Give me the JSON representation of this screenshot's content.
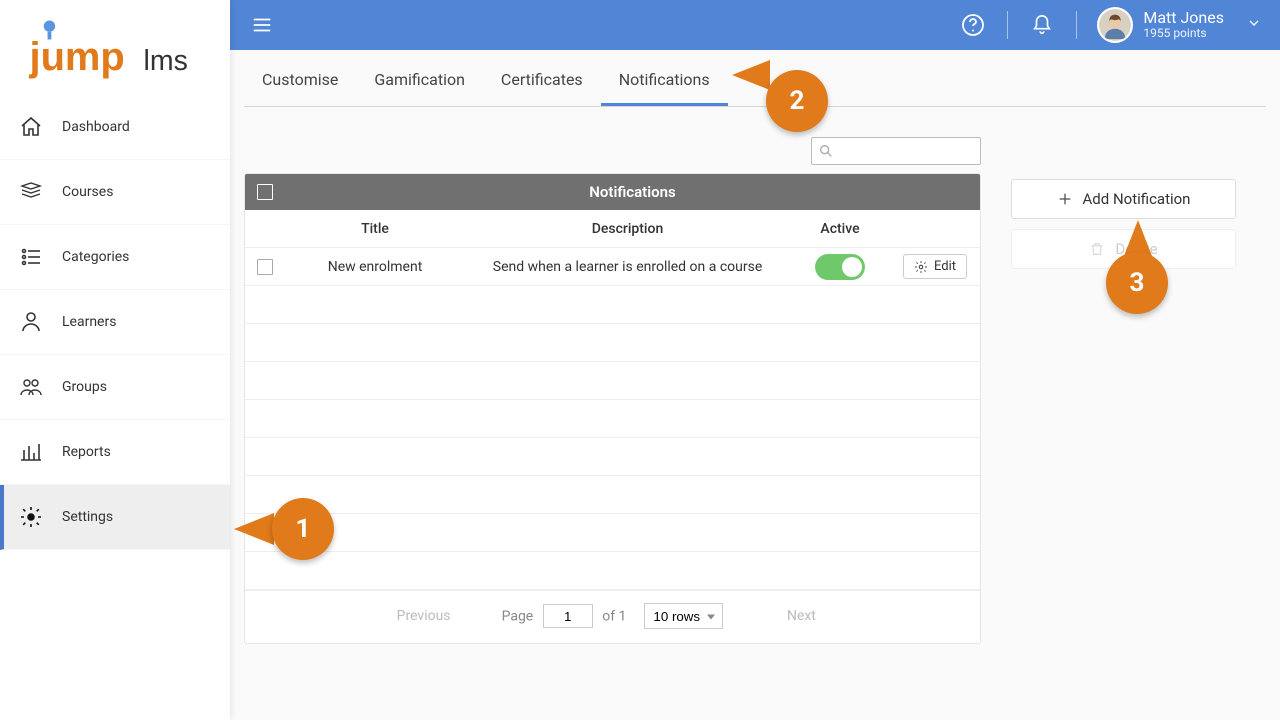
{
  "brand": {
    "text_left": "jump",
    "text_right": "lms",
    "accent": "#e07a1b",
    "secondary": "#5185d6"
  },
  "user": {
    "name": "Matt Jones",
    "points": "1955 points"
  },
  "sidebar": {
    "items": [
      {
        "label": "Dashboard",
        "icon": "home"
      },
      {
        "label": "Courses",
        "icon": "courses"
      },
      {
        "label": "Categories",
        "icon": "categories"
      },
      {
        "label": "Learners",
        "icon": "learner"
      },
      {
        "label": "Groups",
        "icon": "groups"
      },
      {
        "label": "Reports",
        "icon": "reports"
      },
      {
        "label": "Settings",
        "icon": "settings",
        "active": true
      }
    ]
  },
  "tabs": [
    {
      "label": "Customise"
    },
    {
      "label": "Gamification"
    },
    {
      "label": "Certificates"
    },
    {
      "label": "Notifications",
      "active": true
    }
  ],
  "table": {
    "title": "Notifications",
    "columns": {
      "title": "Title",
      "description": "Description",
      "active": "Active"
    },
    "rows": [
      {
        "title": "New enrolment",
        "description": "Send when a learner is enrolled on a course",
        "active": true,
        "action": "Edit"
      }
    ],
    "empty_rows": 8
  },
  "pager": {
    "prev": "Previous",
    "next": "Next",
    "page_label": "Page",
    "page": "1",
    "of_label": "of 1",
    "rows_label": "10 rows"
  },
  "actions": {
    "add": "Add Notification",
    "delete": "Delete"
  },
  "callouts": {
    "c1": "1",
    "c2": "2",
    "c3": "3"
  }
}
